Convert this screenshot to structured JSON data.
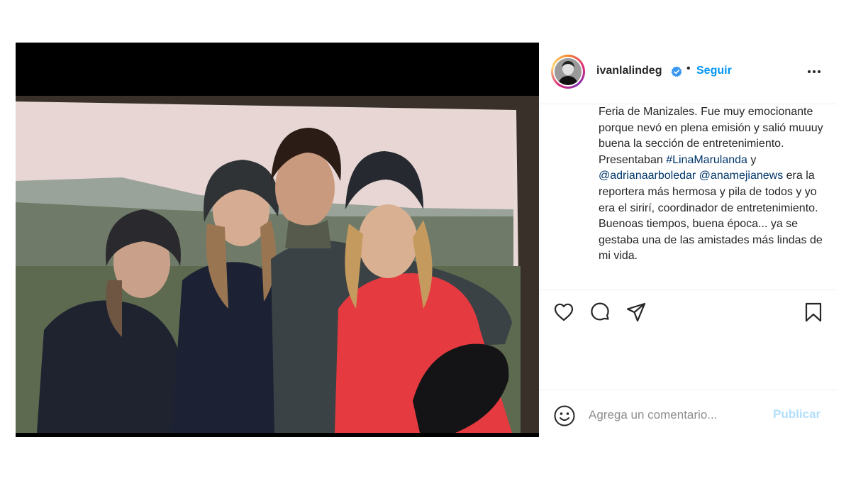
{
  "post": {
    "username": "ivanlalindeg",
    "separator": "•",
    "follow_label": "Seguir",
    "verified_icon": "verified-badge-icon",
    "more_icon": "more-options-icon",
    "caption": {
      "text_1": "Feria de Manizales. Fue muy emocionante porque nevó en plena emisión y salió muuuy buena la sección de entretenimiento. Presentaban ",
      "mention_1": "#LinaMarulanda",
      "text_2": " y ",
      "mention_2": "@adrianaarboledar",
      "text_3": " ",
      "mention_3": "@anamejianews",
      "text_4": " era la reportera más hermosa y pila de todos y yo era el sirirí, coordinador de entretenimiento. Buenoas tiempos, buena época... ya se gestaba una de las amistades más lindas de mi vida."
    }
  },
  "actions": {
    "like_icon": "heart-icon",
    "comment_icon": "comment-icon",
    "share_icon": "paper-plane-icon",
    "save_icon": "bookmark-icon"
  },
  "comment": {
    "emoji_icon": "smiley-icon",
    "placeholder": "Agrega un comentario...",
    "publish_label": "Publicar"
  },
  "colors": {
    "link": "#00376b",
    "follow": "#0095f6",
    "publish_disabled": "#b2dffc",
    "verified": "#3897f0"
  }
}
